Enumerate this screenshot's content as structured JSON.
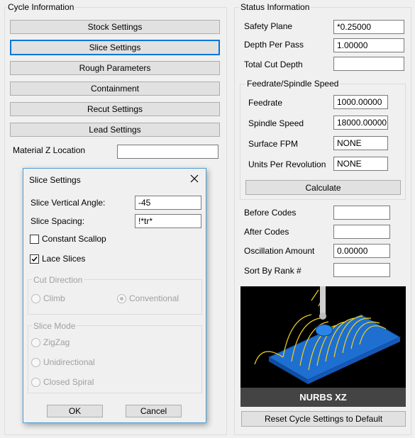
{
  "cycle_info": {
    "title": "Cycle Information",
    "buttons": [
      "Stock Settings",
      "Slice Settings",
      "Rough Parameters",
      "Containment",
      "Recut Settings",
      "Lead Settings"
    ],
    "material_z_label": "Material Z Location",
    "material_z_value": ""
  },
  "status_info": {
    "title": "Status Information",
    "safety_plane_label": "Safety Plane",
    "safety_plane_value": "*0.25000",
    "depth_per_pass_label": "Depth Per Pass",
    "depth_per_pass_value": "1.00000",
    "total_cut_depth_label": "Total Cut Depth",
    "total_cut_depth_value": "",
    "feed_group_title": "Feedrate/Spindle Speed",
    "feedrate_label": "Feedrate",
    "feedrate_value": "1000.00000",
    "spindle_speed_label": "Spindle Speed",
    "spindle_speed_value": "18000.00000",
    "surface_fpm_label": "Surface FPM",
    "surface_fpm_value": "NONE",
    "upr_label": "Units Per Revolution",
    "upr_value": "NONE",
    "calculate_label": "Calculate",
    "before_codes_label": "Before Codes",
    "before_codes_value": "",
    "after_codes_label": "After Codes",
    "after_codes_value": "",
    "oscillation_label": "Oscillation Amount",
    "oscillation_value": "0.00000",
    "sort_rank_label": "Sort By Rank #",
    "sort_rank_value": "",
    "preview_caption": "NURBS XZ",
    "reset_label": "Reset Cycle Settings to Default"
  },
  "dialog": {
    "title": "Slice Settings",
    "vertical_angle_label": "Slice Vertical Angle:",
    "vertical_angle_value": "-45",
    "spacing_label": "Slice Spacing:",
    "spacing_value": "!*tr*",
    "constant_scallop_label": "Constant Scallop",
    "constant_scallop_checked": false,
    "lace_slices_label": "Lace Slices",
    "lace_slices_checked": true,
    "cut_direction_title": "Cut Direction",
    "climb_label": "Climb",
    "conventional_label": "Conventional",
    "slice_mode_title": "Slice Mode",
    "zigzag_label": "ZigZag",
    "unidirectional_label": "Unidirectional",
    "closed_spiral_label": "Closed Spiral",
    "ok_label": "OK",
    "cancel_label": "Cancel"
  },
  "colors": {
    "focus_accent": "#0078d7",
    "preview_part": "#1e6fd0",
    "preview_toolpath": "#f2d21c"
  }
}
